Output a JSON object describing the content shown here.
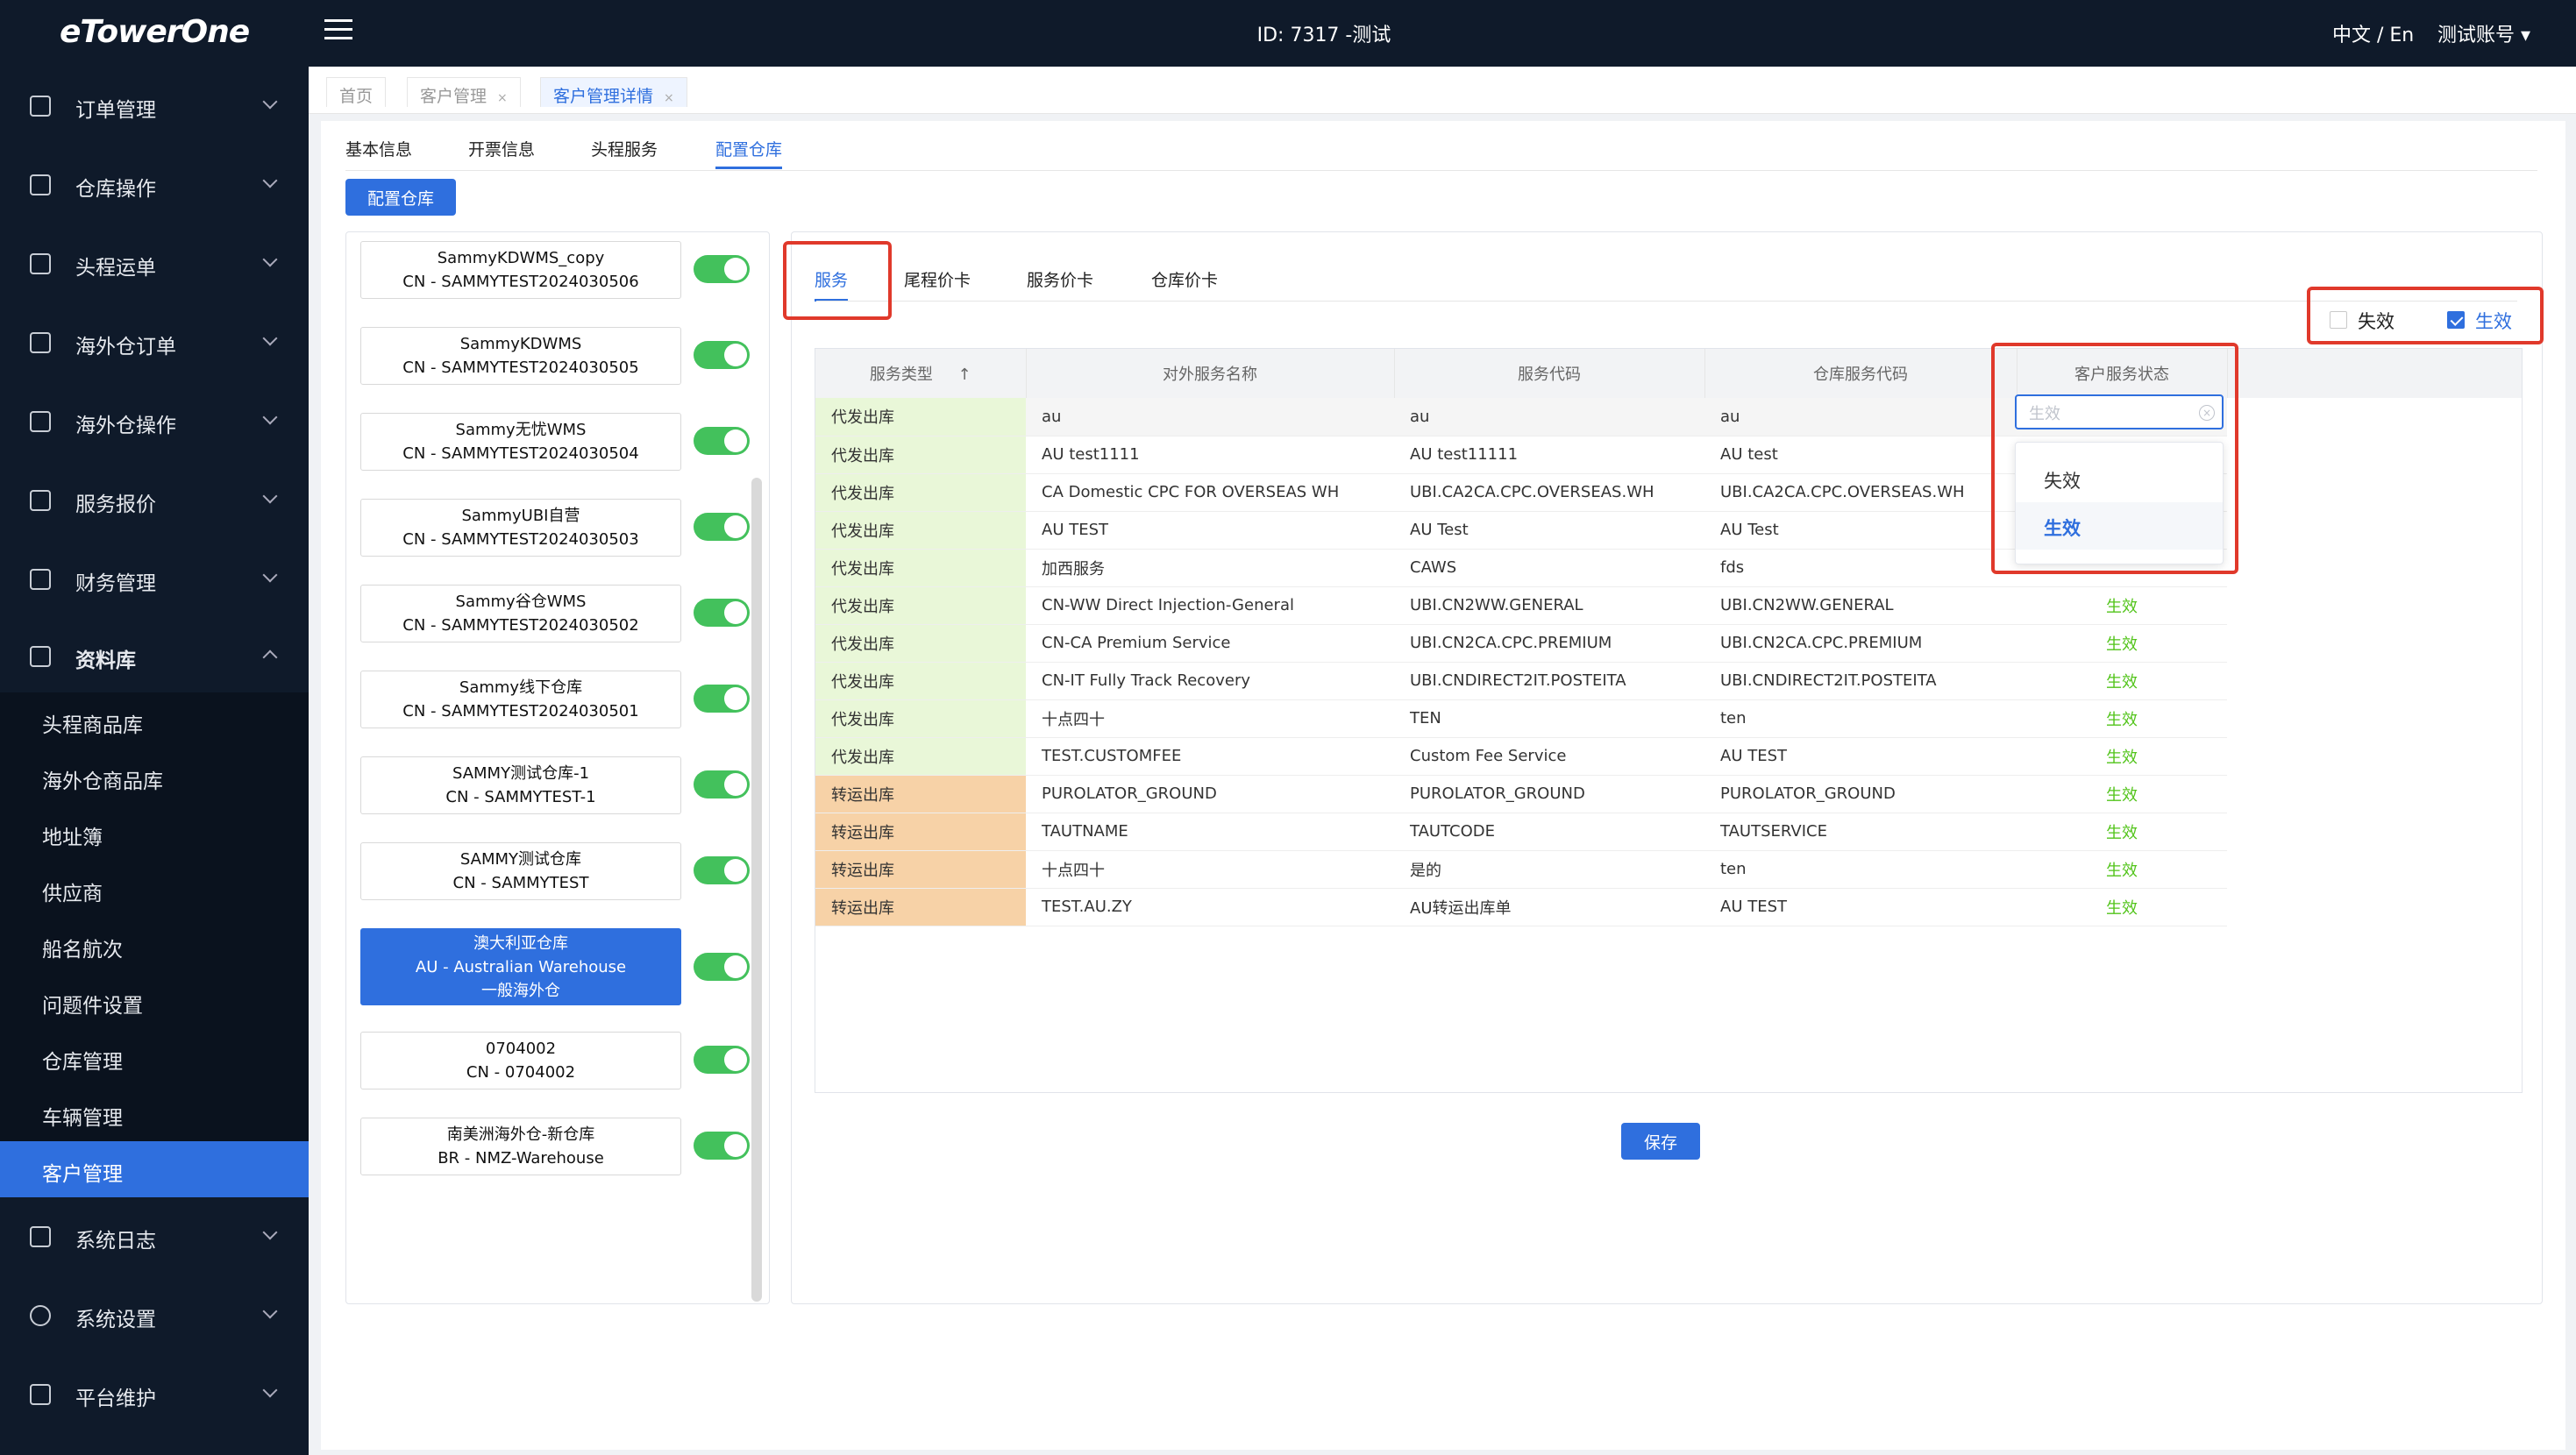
{
  "app": {
    "logo": "eTowerOne",
    "center_title": "ID: 7317 -测试",
    "lang": "中文 / En",
    "account": "测试账号 ▾"
  },
  "sidebar": {
    "items": [
      {
        "label": "订单管理",
        "icon": "order-icon"
      },
      {
        "label": "仓库操作",
        "icon": "warehouse-icon"
      },
      {
        "label": "头程运单",
        "icon": "shipment-icon"
      },
      {
        "label": "海外仓订单",
        "icon": "overseas-order-icon"
      },
      {
        "label": "海外仓操作",
        "icon": "overseas-ops-icon"
      },
      {
        "label": "服务报价",
        "icon": "quote-icon"
      },
      {
        "label": "财务管理",
        "icon": "finance-icon"
      },
      {
        "label": "资料库",
        "icon": "database-icon"
      },
      {
        "label": "系统日志",
        "icon": "log-icon"
      },
      {
        "label": "系统设置",
        "icon": "settings-icon"
      },
      {
        "label": "平台维护",
        "icon": "maintenance-icon"
      }
    ],
    "sub_items": [
      "头程商品库",
      "海外仓商品库",
      "地址簿",
      "供应商",
      "船名航次",
      "问题件设置",
      "仓库管理",
      "车辆管理",
      "客户管理"
    ]
  },
  "tabs": [
    {
      "label": "首页"
    },
    {
      "label": "客户管理",
      "close": "×"
    },
    {
      "label": "客户管理详情",
      "close": "×"
    }
  ],
  "detail_tabs": [
    "基本信息",
    "开票信息",
    "头程服务",
    "配置仓库"
  ],
  "config_button": "配置仓库",
  "warehouses": [
    {
      "name": "SammyKDWMS_copy",
      "code": "CN - SAMMYTEST2024030506",
      "enabled": true
    },
    {
      "name": "SammyKDWMS",
      "code": "CN - SAMMYTEST2024030505",
      "enabled": true
    },
    {
      "name": "Sammy无忧WMS",
      "code": "CN - SAMMYTEST2024030504",
      "enabled": true
    },
    {
      "name": "SammyUBI自营",
      "code": "CN - SAMMYTEST2024030503",
      "enabled": true
    },
    {
      "name": "Sammy谷仓WMS",
      "code": "CN - SAMMYTEST2024030502",
      "enabled": true
    },
    {
      "name": "Sammy线下仓库",
      "code": "CN - SAMMYTEST2024030501",
      "enabled": true
    },
    {
      "name": "SAMMY测试仓库-1",
      "code": "CN - SAMMYTEST-1",
      "enabled": true
    },
    {
      "name": "SAMMY测试仓库",
      "code": "CN - SAMMYTEST",
      "enabled": true
    },
    {
      "name": "澳大利亚仓库",
      "code": "AU - Australian Warehouse",
      "extra": "一般海外仓",
      "enabled": true,
      "active": true
    },
    {
      "name": "0704002",
      "code": "CN - 0704002",
      "enabled": true
    },
    {
      "name": "南美洲海外仓-新仓库",
      "code": "BR - NMZ-Warehouse",
      "enabled": true
    }
  ],
  "service_tabs": [
    "服务",
    "尾程价卡",
    "服务价卡",
    "仓库价卡"
  ],
  "filters": {
    "inactive": "失效",
    "active": "生效"
  },
  "table": {
    "headers": [
      "服务类型",
      "对外服务名称",
      "服务代码",
      "仓库服务代码",
      "客户服务状态"
    ],
    "sort_icon": "↑",
    "rows": [
      {
        "type": "代发出库",
        "name": "au",
        "code": "au",
        "wh_code": "au",
        "status": ""
      },
      {
        "type": "代发出库",
        "name": "AU test1111",
        "code": "AU test11111",
        "wh_code": "AU test",
        "status": ""
      },
      {
        "type": "代发出库",
        "name": "CA Domestic CPC FOR OVERSEAS WH",
        "code": "UBI.CA2CA.CPC.OVERSEAS.WH",
        "wh_code": "UBI.CA2CA.CPC.OVERSEAS.WH",
        "status": ""
      },
      {
        "type": "代发出库",
        "name": "AU TEST",
        "code": "AU Test",
        "wh_code": "AU Test",
        "status": ""
      },
      {
        "type": "代发出库",
        "name": "加西服务",
        "code": "CAWS",
        "wh_code": "fds",
        "status": ""
      },
      {
        "type": "代发出库",
        "name": "CN-WW Direct Injection-General",
        "code": "UBI.CN2WW.GENERAL",
        "wh_code": "UBI.CN2WW.GENERAL",
        "status": "生效"
      },
      {
        "type": "代发出库",
        "name": "CN-CA Premium Service",
        "code": "UBI.CN2CA.CPC.PREMIUM",
        "wh_code": "UBI.CN2CA.CPC.PREMIUM",
        "status": "生效"
      },
      {
        "type": "代发出库",
        "name": "CN-IT Fully Track Recovery",
        "code": "UBI.CNDIRECT2IT.POSTEITA",
        "wh_code": "UBI.CNDIRECT2IT.POSTEITA",
        "status": "生效"
      },
      {
        "type": "代发出库",
        "name": "十点四十",
        "code": "TEN",
        "wh_code": "ten",
        "status": "生效"
      },
      {
        "type": "代发出库",
        "name": "TEST.CUSTOMFEE",
        "code": "Custom Fee Service",
        "wh_code": "AU TEST",
        "status": "生效"
      },
      {
        "type": "转运出库",
        "name": "PUROLATOR_GROUND",
        "code": "PUROLATOR_GROUND",
        "wh_code": "PUROLATOR_GROUND",
        "status": "生效"
      },
      {
        "type": "转运出库",
        "name": "TAUTNAME",
        "code": "TAUTCODE",
        "wh_code": "TAUTSERVICE",
        "status": "生效"
      },
      {
        "type": "转运出库",
        "name": "十点四十",
        "code": "是的",
        "wh_code": "ten",
        "status": "生效"
      },
      {
        "type": "转运出库",
        "name": "TEST.AU.ZY",
        "code": "AU转运出库单",
        "wh_code": "AU TEST",
        "status": "生效"
      }
    ]
  },
  "status_dropdown": {
    "placeholder": "生效",
    "options": [
      "失效",
      "生效"
    ],
    "selected": "生效"
  },
  "save_button": "保存",
  "colors": {
    "primary": "#2f6fde",
    "active_status": "#52c41a",
    "toggle_on": "#43c15c",
    "highlight_border": "#e0392b",
    "type_dispatch_bg": "#e9f7d8",
    "type_transfer_bg": "#f7d2a7"
  }
}
